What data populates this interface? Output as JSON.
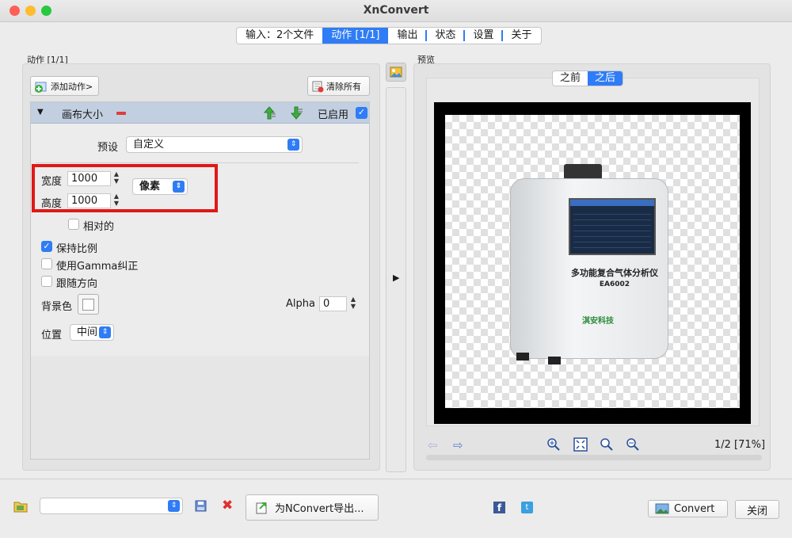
{
  "window": {
    "title": "XnConvert"
  },
  "tabs": [
    {
      "label": "输入：2个文件"
    },
    {
      "label": "动作 [1/1]"
    },
    {
      "label": "输出"
    },
    {
      "label": "状态"
    },
    {
      "label": "设置"
    },
    {
      "label": "关于"
    }
  ],
  "left": {
    "group_label": "动作 [1/1]",
    "add_action": "添加动作>",
    "clear_all": "清除所有",
    "action": {
      "name": "画布大小",
      "enabled_label": "已启用",
      "enabled": true,
      "preset_label": "预设",
      "preset_value": "自定义",
      "width_label": "宽度",
      "width_value": "1000",
      "height_label": "高度",
      "height_value": "1000",
      "unit_value": "像素",
      "relative_label": "相对的",
      "relative": false,
      "keep_ratio_label": "保持比例",
      "keep_ratio": true,
      "gamma_label": "使用Gamma纠正",
      "gamma": false,
      "orientation_label": "跟随方向",
      "orientation": false,
      "bg_label": "背景色",
      "alpha_label": "Alpha",
      "alpha_value": "0",
      "position_label": "位置",
      "position_value": "中间"
    }
  },
  "preview": {
    "group_label": "预览",
    "before": "之前",
    "after": "之后",
    "page_info": "1/2 [71%]",
    "image_text": {
      "title": "多功能复合气体分析仪",
      "model": "EA6002",
      "brand": "淇安科技"
    }
  },
  "bottom": {
    "export_label": "为NConvert导出...",
    "convert": "Convert",
    "close": "关闭"
  },
  "colors": {
    "accent": "#2f7cf6",
    "highlight_box": "#e01818"
  }
}
